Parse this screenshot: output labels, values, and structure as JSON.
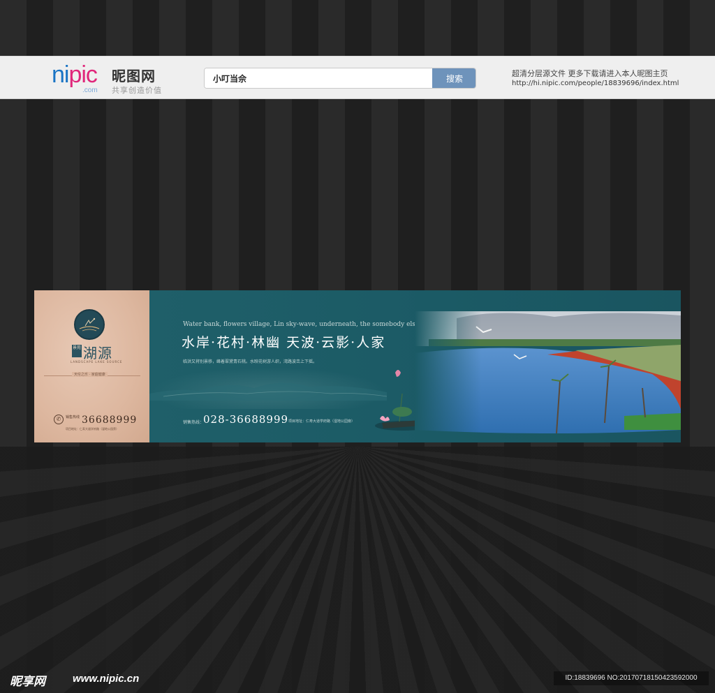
{
  "header": {
    "logo_prefix": "ni",
    "logo_suffix": "pic",
    "logo_com": ".com",
    "logo_cn": "昵图网",
    "slogan": "共享创造价值",
    "search_value": "小叮当佘",
    "search_button": "搜索",
    "info_line": "超清分层源文件  更多下载请进入本人昵图主页",
    "info_url": "http://hi.nipic.com/people/18839696/index.html"
  },
  "banner": {
    "left": {
      "stamp": "景苑",
      "brand": "湖源",
      "en": "LANDSCAPE LAKE SOURCE",
      "small_text": "天伦之乐 · 家庭健康",
      "phone_label": "销售热线",
      "phone_number": "36688999",
      "address": "项目地址：仁寿大道学府路（湿地公园旁）"
    },
    "right": {
      "en_line": "Water bank, flowers village, Lin sky-wave, underneath, the somebody else",
      "cn_title": "水岸·花村·林幽   天波·云影·人家",
      "cn_sub": "临洪又将别景移，峰着翠黛青石桃。水映花树游人织，湾路波峦上下摇。",
      "hotline_label": "销售热线：",
      "hotline_number": "028-36688999",
      "address": "项目地址：仁寿大道学府路（湿地公园旁）"
    }
  },
  "footer": {
    "logo": "昵享网",
    "site": "www.nipic.cn",
    "id": "ID:18839696 NO:20170718150423592000"
  },
  "colors": {
    "teal": "#1f5f69",
    "paper": "#ddb79f",
    "search_button": "#6e93bb",
    "nipic_blue": "#1a74c4",
    "nipic_pink": "#e0267a"
  }
}
